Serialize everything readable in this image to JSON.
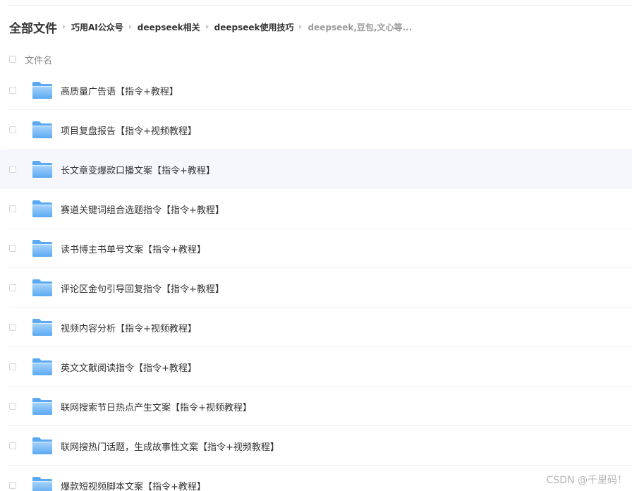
{
  "breadcrumb": {
    "root": "全部文件",
    "items": [
      "巧用AI公众号",
      "deepseek相关",
      "deepseek使用技巧"
    ],
    "current": "deepseek,豆包,文心等..."
  },
  "list_header": {
    "name_label": "文件名"
  },
  "files": [
    {
      "name": "高质量广告语【指令+教程】",
      "type": "folder"
    },
    {
      "name": "项目复盘报告【指令+视频教程】",
      "type": "folder"
    },
    {
      "name": "长文章变爆款口播文案【指令+教程】",
      "type": "folder",
      "hovered": true
    },
    {
      "name": "赛道关键词组合选题指令【指令+教程】",
      "type": "folder"
    },
    {
      "name": "读书博主书单号文案【指令+教程】",
      "type": "folder"
    },
    {
      "name": "评论区金句引导回复指令【指令+教程】",
      "type": "folder"
    },
    {
      "name": "视频内容分析【指令+视频教程】",
      "type": "folder"
    },
    {
      "name": "英文文献阅读指令【指令+教程】",
      "type": "folder"
    },
    {
      "name": "联网搜索节日热点产生文案【指令+视频教程】",
      "type": "folder"
    },
    {
      "name": "联网搜热门话题，生成故事性文案【指令+视频教程】",
      "type": "folder"
    },
    {
      "name": "爆款短视频脚本文案【指令+教程】",
      "type": "folder"
    }
  ],
  "watermark": "CSDN @千里码！",
  "colors": {
    "folder_light": "#a9d4fb",
    "folder_dark": "#5aa9f2",
    "hover_row": "#f5f7fd"
  }
}
